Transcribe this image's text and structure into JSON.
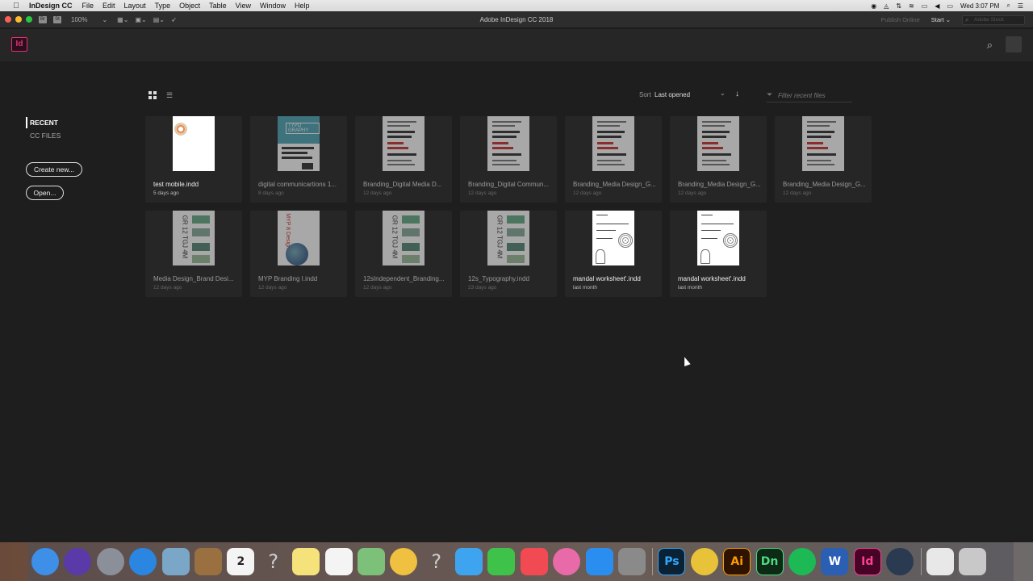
{
  "menubar": {
    "app_name": "InDesign CC",
    "menus": [
      "File",
      "Edit",
      "Layout",
      "Type",
      "Object",
      "Table",
      "View",
      "Window",
      "Help"
    ],
    "clock": "Wed 3:07 PM"
  },
  "titlebar": {
    "title": "Adobe InDesign CC 2018",
    "zoom": "100%",
    "br_label": "Br",
    "st_label": "St",
    "publish": "Publish Online",
    "start": "Start",
    "stock_placeholder": "Adobe Stock"
  },
  "header": {
    "logo": "Id"
  },
  "sidebar": {
    "recent": "RECENT",
    "cc_files": "CC FILES",
    "create_new": "Create new...",
    "open": "Open..."
  },
  "toolbar": {
    "sort_label": "Sort",
    "sort_value": "Last opened",
    "filter_placeholder": "Filter recent files"
  },
  "files": [
    {
      "name": "test mobile.indd",
      "date": "5 days ago",
      "thumb": "mobile"
    },
    {
      "name": "digital communicartions 1...",
      "date": "8 days ago",
      "thumb": "typo"
    },
    {
      "name": "Branding_Digital Media D...",
      "date": "12 days ago",
      "thumb": "doc"
    },
    {
      "name": "Branding_Digital Commun...",
      "date": "12 days ago",
      "thumb": "doc"
    },
    {
      "name": "Branding_Media Design_G...",
      "date": "12 days ago",
      "thumb": "doc"
    },
    {
      "name": "Branding_Media Design_G...",
      "date": "12 days ago",
      "thumb": "doc"
    },
    {
      "name": "Branding_Media Design_G...",
      "date": "12 days ago",
      "thumb": "doc"
    },
    {
      "name": "Media Design_Brand Desi...",
      "date": "12 days ago",
      "thumb": "gr",
      "thumb_text": "GR 12 TGJ 4M"
    },
    {
      "name": "MYP Branding I.indd",
      "date": "12 days ago",
      "thumb": "myp",
      "thumb_text": "MYP 8 Design"
    },
    {
      "name": "12sIndependent_Branding...",
      "date": "12 days ago",
      "thumb": "gr",
      "thumb_text": "GR 12 TGJ 4M"
    },
    {
      "name": "12s_Typography.indd",
      "date": "23 days ago",
      "thumb": "gr",
      "thumb_text": "GR 12 TGJ 4M"
    },
    {
      "name": "mandal worksheet'.indd",
      "date": "last month",
      "thumb": "mandal"
    },
    {
      "name": "mandal worksheet'.indd",
      "date": "last month",
      "thumb": "mandal"
    }
  ],
  "thumb_label_typo": "TYPO GRAPHY",
  "dock": {
    "icons": [
      {
        "name": "finder-icon",
        "label": "",
        "color": "#3d8fe8"
      },
      {
        "name": "siri-icon",
        "label": "",
        "color": "#5a3aa8"
      },
      {
        "name": "launchpad-icon",
        "label": "",
        "color": "#8a8f99"
      },
      {
        "name": "safari-icon",
        "label": "",
        "color": "#2a86e0"
      },
      {
        "name": "preview-icon",
        "label": "",
        "color": "#7aa6c8"
      },
      {
        "name": "notefile-icon",
        "label": "",
        "color": "#9a7040"
      },
      {
        "name": "calendar-icon",
        "label": "2",
        "color": "#f4f4f4"
      },
      {
        "name": "unknown-app-icon",
        "label": "?",
        "color": "transparent"
      },
      {
        "name": "notes-icon",
        "label": "",
        "color": "#f6e27a"
      },
      {
        "name": "reminders-icon",
        "label": "",
        "color": "#f4f4f4"
      },
      {
        "name": "maps-icon",
        "label": "",
        "color": "#7cc07a"
      },
      {
        "name": "photos-icon",
        "label": "",
        "color": "#f0c040"
      },
      {
        "name": "unknown-app-2-icon",
        "label": "?",
        "color": "transparent"
      },
      {
        "name": "messages-icon",
        "label": "",
        "color": "#3fa4f0"
      },
      {
        "name": "facetime-icon",
        "label": "",
        "color": "#3ec24a"
      },
      {
        "name": "news-icon",
        "label": "",
        "color": "#f24a52"
      },
      {
        "name": "itunes-icon",
        "label": "",
        "color": "#e86aa8"
      },
      {
        "name": "app-store-icon",
        "label": "",
        "color": "#2a8ef0"
      },
      {
        "name": "system-preferences-icon",
        "label": "",
        "color": "#8a8a8a"
      },
      {
        "name": "photoshop-icon",
        "label": "Ps",
        "color": "#0b2234"
      },
      {
        "name": "chrome-icon",
        "label": "",
        "color": "#e8c33a"
      },
      {
        "name": "illustrator-icon",
        "label": "Ai",
        "color": "#2d1300"
      },
      {
        "name": "dimension-icon",
        "label": "Dn",
        "color": "#0c2a16"
      },
      {
        "name": "spotify-icon",
        "label": "",
        "color": "#1db954"
      },
      {
        "name": "word-icon",
        "label": "W",
        "color": "#2b5fb4"
      },
      {
        "name": "indesign-icon",
        "label": "Id",
        "color": "#470427"
      },
      {
        "name": "quicktime-icon",
        "label": "",
        "color": "#2a3a50"
      },
      {
        "name": "document-icon",
        "label": "",
        "color": "#e8e8e8"
      },
      {
        "name": "trash-icon",
        "label": "",
        "color": "#c8c8c8"
      }
    ]
  }
}
